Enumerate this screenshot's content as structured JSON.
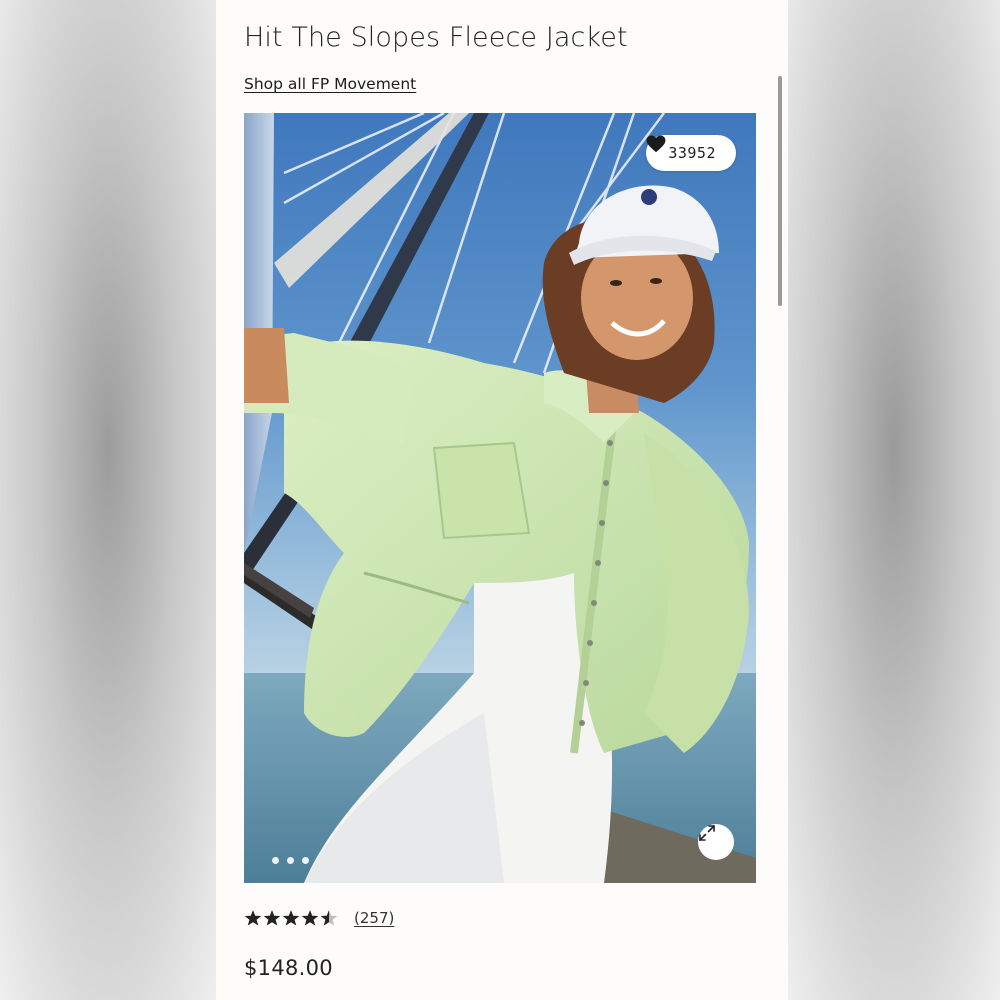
{
  "product": {
    "title": "Hit The Slopes Fleece Jacket",
    "shop_link": "Shop all FP Movement",
    "likes": "33952",
    "rating_value": 4.5,
    "review_count": "(257)",
    "price": "$148.00"
  },
  "gallery": {
    "total_images": 3,
    "current_index": 1
  },
  "icons": {
    "like": "heart-icon",
    "expand": "expand-icon",
    "rating": "star-icon"
  },
  "colors": {
    "text": "#222222",
    "background": "#fdfcfb",
    "jacket": "#cfe6b4",
    "sky": "#5f95cc"
  }
}
